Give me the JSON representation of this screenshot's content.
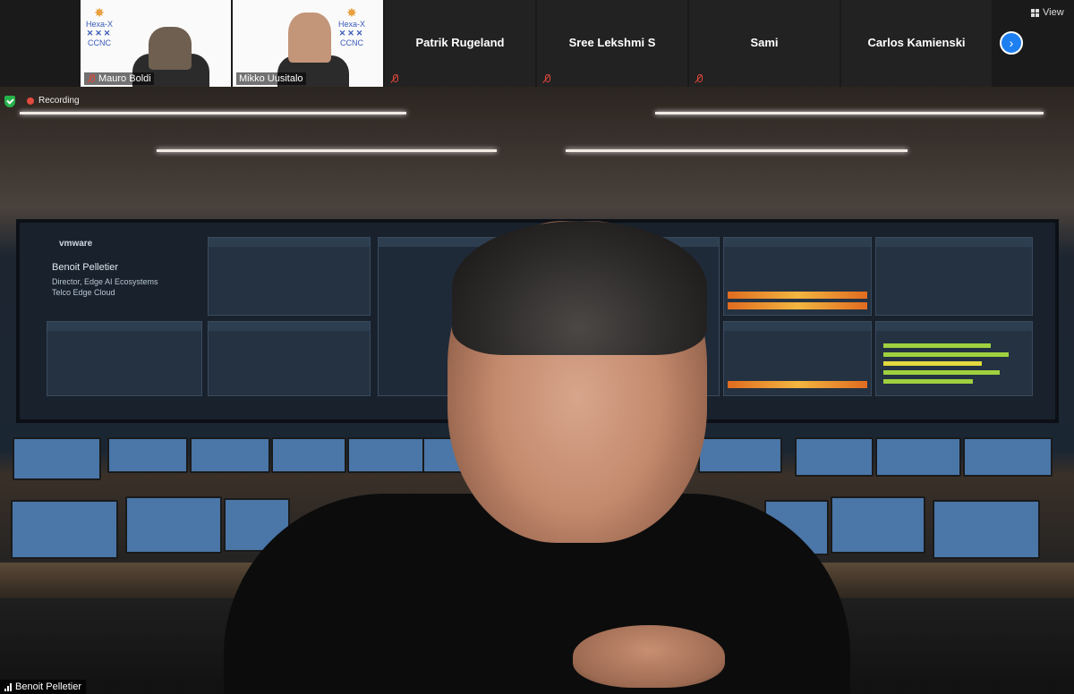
{
  "participants": [
    {
      "name": "Mauro Boldi",
      "logo_text": "Hexa-X",
      "logo_sub": "CCNC"
    },
    {
      "name": "Mikko Uusitalo",
      "logo_text": "Hexa-X",
      "logo_sub": "CCNC"
    },
    {
      "name": "Patrik Rugeland"
    },
    {
      "name": "Sree Lekshmi S"
    },
    {
      "name": "Sami"
    },
    {
      "name": "Carlos Kamienski"
    }
  ],
  "controls": {
    "view_label": "View",
    "next_icon": "chevron-right-icon"
  },
  "main": {
    "recording_label": "Recording",
    "speaker_name": "Benoit Pelletier",
    "wall": {
      "brand": "vmware",
      "name": "Benoit Pelletier",
      "role_line1": "Director, Edge AI Ecosystems",
      "role_line2": "Telco Edge Cloud"
    }
  },
  "colors": {
    "accent": "#1e7ff0",
    "muted": "#e0483b",
    "secure": "#26b24a"
  }
}
